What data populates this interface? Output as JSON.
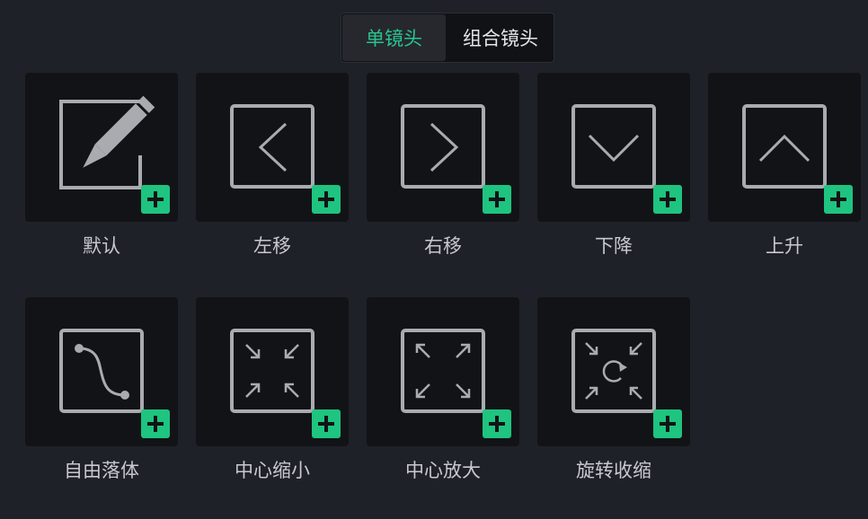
{
  "tabs": [
    {
      "label": "单镜头",
      "active": true
    },
    {
      "label": "组合镜头",
      "active": false
    }
  ],
  "presets": [
    {
      "label": "默认",
      "icon": "pencil-icon"
    },
    {
      "label": "左移",
      "icon": "chevron-left-icon"
    },
    {
      "label": "右移",
      "icon": "chevron-right-icon"
    },
    {
      "label": "下降",
      "icon": "chevron-down-icon"
    },
    {
      "label": "上升",
      "icon": "chevron-up-icon"
    },
    {
      "label": "自由落体",
      "icon": "curve-path-icon"
    },
    {
      "label": "中心缩小",
      "icon": "arrows-inward-icon"
    },
    {
      "label": "中心放大",
      "icon": "arrows-outward-icon"
    },
    {
      "label": "旋转收缩",
      "icon": "rotate-shrink-icon"
    }
  ],
  "colors": {
    "accent": "#28c58e",
    "add_button": "#1ec47f",
    "background": "#1f2128",
    "card": "#121316",
    "icon_stroke": "#a9abb0"
  }
}
